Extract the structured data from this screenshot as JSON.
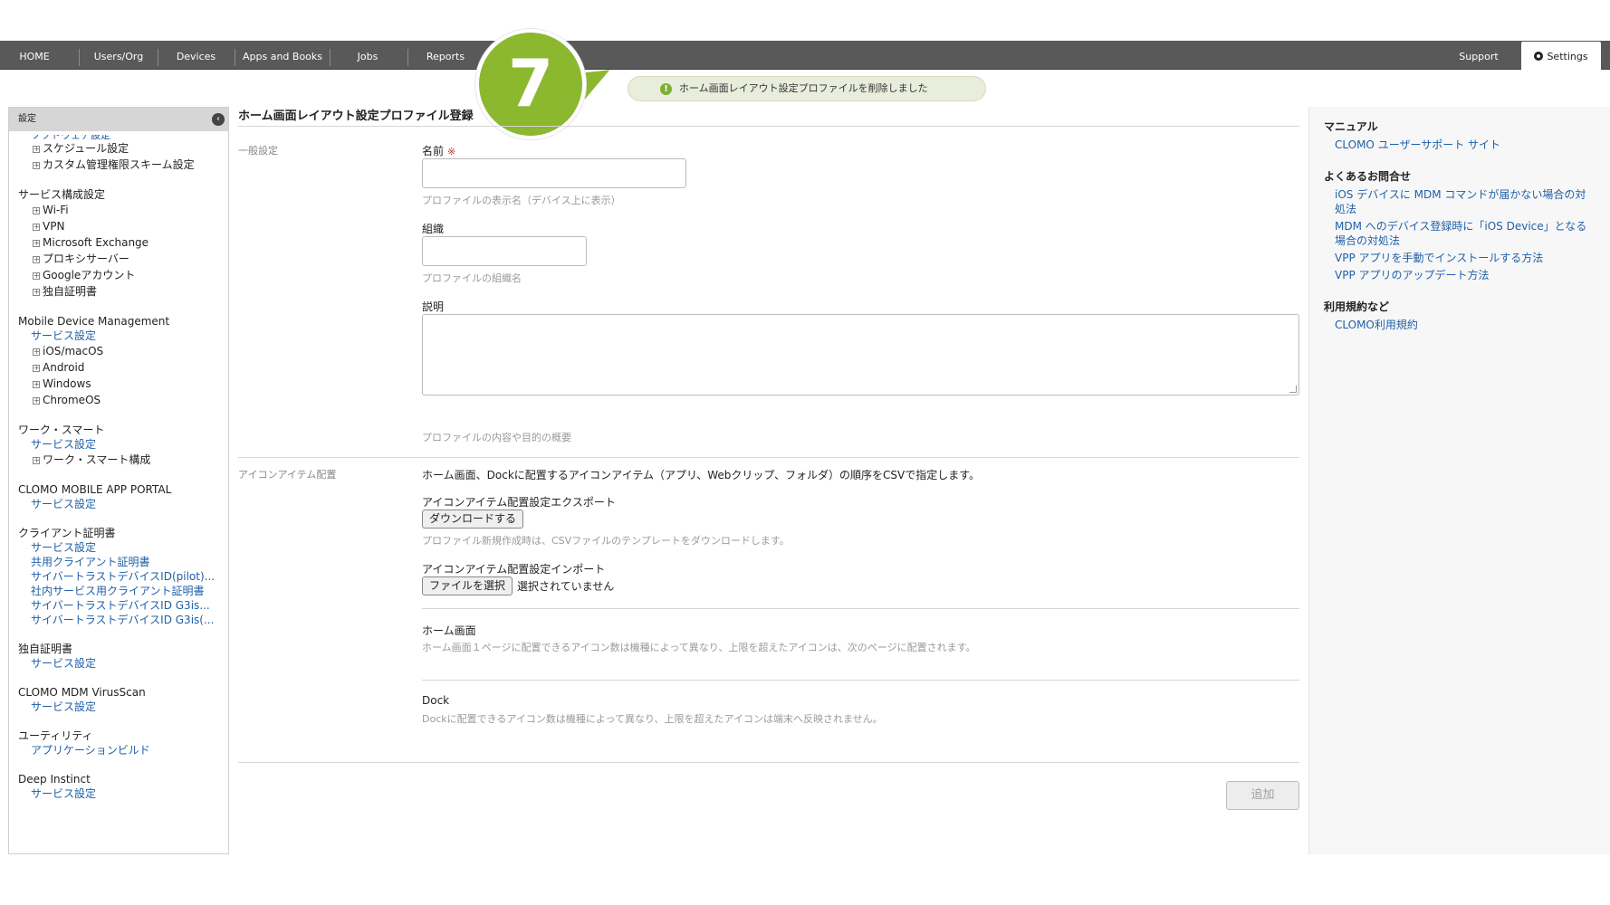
{
  "nav": {
    "items": [
      "HOME",
      "Users/Org",
      "Devices",
      "Apps and Books",
      "Jobs",
      "Reports"
    ],
    "support": "Support",
    "settings": "Settings"
  },
  "step_badge": "7",
  "toast": {
    "message": "ホーム画面レイアウト設定プロファイルを削除しました",
    "icon": "!"
  },
  "sidebar": {
    "header": "設定",
    "collapse_icon": "‹",
    "cut_link": "ソフトウェア設定",
    "top_items": [
      "スケジュール設定",
      "カスタム管理権限スキーム設定"
    ],
    "groups": [
      {
        "title": "サービス構成設定",
        "links": [],
        "items": [
          "Wi-Fi",
          "VPN",
          "Microsoft Exchange",
          "プロキシサーバー",
          "Googleアカウント",
          "独自証明書"
        ]
      },
      {
        "title": "Mobile Device Management",
        "links": [
          "サービス設定"
        ],
        "items": [
          "iOS/macOS",
          "Android",
          "Windows",
          "ChromeOS"
        ]
      },
      {
        "title": "ワーク・スマート",
        "links": [
          "サービス設定"
        ],
        "items": [
          "ワーク・スマート構成"
        ]
      },
      {
        "title": "CLOMO MOBILE APP PORTAL",
        "links": [
          "サービス設定"
        ],
        "items": []
      },
      {
        "title": "クライアント証明書",
        "links": [
          "サービス設定",
          "共用クライアント証明書",
          "サイバートラストデバイスID(pilot)...",
          "社内サービス用クライアント証明書",
          "サイバートラストデバイスID G3is...",
          "サイバートラストデバイスID G3is(..."
        ],
        "items": []
      },
      {
        "title": "独自証明書",
        "links": [
          "サービス設定"
        ],
        "items": []
      },
      {
        "title": "CLOMO MDM VirusScan",
        "links": [
          "サービス設定"
        ],
        "items": []
      },
      {
        "title": "ユーティリティ",
        "links": [
          "アプリケーションビルド"
        ],
        "items": []
      },
      {
        "title": "Deep Instinct",
        "links": [
          "サービス設定"
        ],
        "items": []
      }
    ]
  },
  "main": {
    "title": "ホーム画面レイアウト設定プロファイル登録",
    "general_section": "一般設定",
    "name_label": "名前",
    "required_mark": "※",
    "name_hint": "プロファイルの表示名（デバイス上に表示）",
    "org_label": "組織",
    "org_hint": "プロファイルの組織名",
    "desc_label": "説明",
    "desc_hint": "プロファイルの内容や目的の概要",
    "icon_section": "アイコンアイテム配置",
    "icon_desc": "ホーム画面、Dockに配置するアイコンアイテム（アプリ、Webクリップ、フォルダ）の順序をCSVで指定します。",
    "export_label": "アイコンアイテム配置設定エクスポート",
    "download_button": "ダウンロードする",
    "export_hint": "プロファイル新規作成時は、CSVファイルのテンプレートをダウンロードします。",
    "import_label": "アイコンアイテム配置設定インポート",
    "file_button": "ファイルを選択",
    "file_status": "選択されていません",
    "home_label": "ホーム画面",
    "home_hint": "ホーム画面１ページに配置できるアイコン数は機種によって異なり、上限を超えたアイコンは、次のページに配置されます。",
    "dock_label": "Dock",
    "dock_hint": "Dockに配置できるアイコン数は機種によって異なり、上限を超えたアイコンは端末へ反映されません。",
    "add_button": "追加"
  },
  "rightbar": {
    "manual_title": "マニュアル",
    "manual_links": [
      "CLOMO ユーザーサポート サイト"
    ],
    "faq_title": "よくあるお問合せ",
    "faq_links": [
      "iOS デバイスに MDM コマンドが届かない場合の対処法",
      "MDM へのデバイス登録時に「iOS Device」となる場合の対処法",
      "VPP アプリを手動でインストールする方法",
      "VPP アプリのアップデート方法"
    ],
    "terms_title": "利用規約など",
    "terms_links": [
      "CLOMO利用規約"
    ]
  }
}
